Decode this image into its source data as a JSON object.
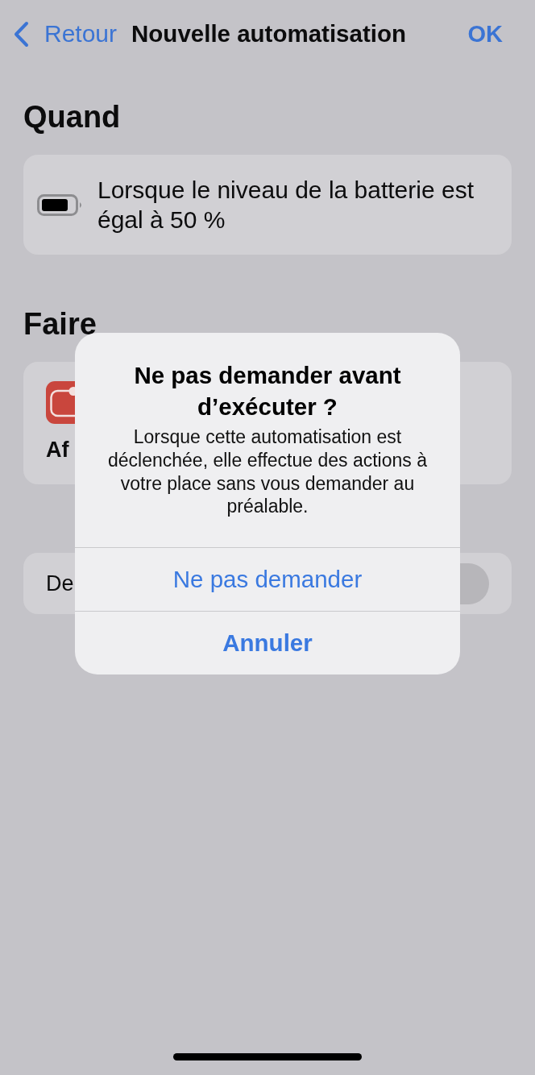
{
  "nav_bar": {
    "back_label": "Retour",
    "title": "Nouvelle automatisation",
    "done_label": "OK"
  },
  "sections": [
    {
      "header": "Quand",
      "card": {
        "kind": "trigger",
        "text": "Lorsque le niveau de la batterie est égal à 50 %"
      }
    },
    {
      "header": "Faire",
      "card": {
        "kind": "action",
        "text": "Af"
      }
    },
    {
      "card": {
        "kind": "toggle",
        "text": "De",
        "on": false
      }
    }
  ],
  "alert": {
    "title": "Ne pas demander avant d’exécuter ?",
    "message": "Lorsque cette automatisation est déclenchée, elle effectue des actions à votre place sans vous demander au préalable.",
    "buttons": [
      {
        "label": "Ne pas demander",
        "kind": "default"
      },
      {
        "label": "Annuler",
        "kind": "cancel"
      }
    ]
  }
}
